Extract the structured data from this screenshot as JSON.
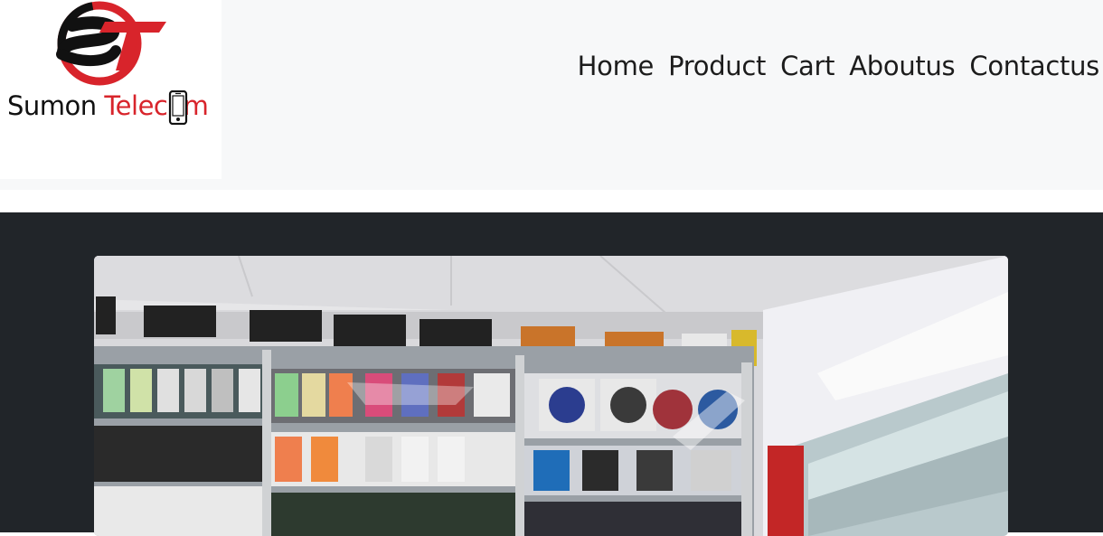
{
  "brand": {
    "name_part1": "Sumon",
    "name_part2": "Telecom",
    "monogram": "ST",
    "colors": {
      "red": "#d8242b",
      "black": "#111111"
    }
  },
  "nav": {
    "items": [
      {
        "label": "Home"
      },
      {
        "label": "Product"
      },
      {
        "label": "Cart"
      },
      {
        "label": "Aboutus"
      },
      {
        "label": "Contactus"
      }
    ]
  },
  "theme": {
    "navbar_bg": "#f7f8f9",
    "hero_bg": "#212529"
  },
  "hero": {
    "image_subject": "mobile accessories shop interior with glass display shelves"
  }
}
